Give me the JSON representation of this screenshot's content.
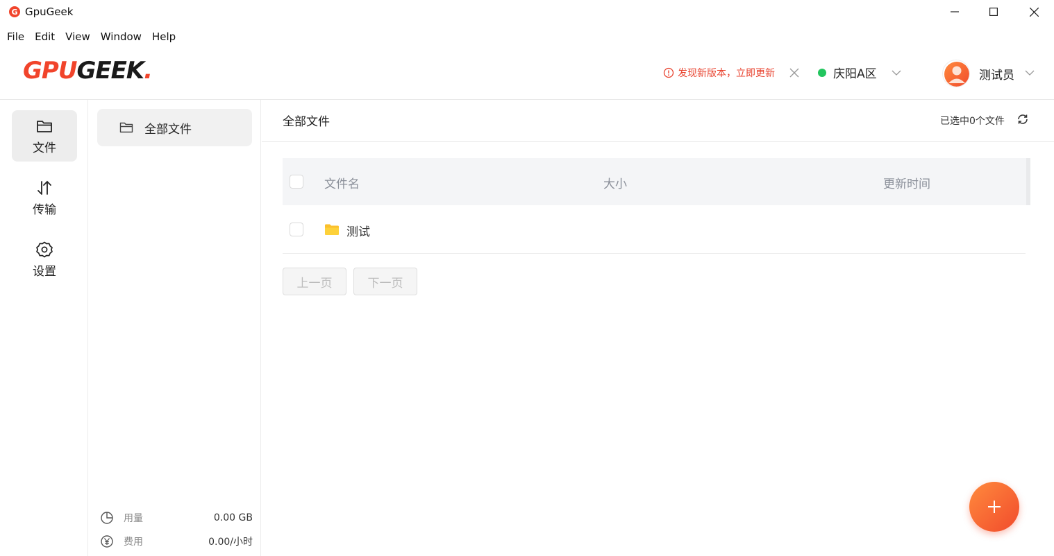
{
  "window": {
    "title": "GpuGeek",
    "icon": "gpugeek-app-icon"
  },
  "menu": [
    "File",
    "Edit",
    "View",
    "Window",
    "Help"
  ],
  "header": {
    "logo_gpu": "GPU",
    "logo_geek": "GEEK",
    "logo_dot": ".",
    "update_notice": "发现新版本，立即更新",
    "region": "庆阳A区",
    "user_name": "测试员"
  },
  "nav": [
    {
      "label": "文件",
      "icon": "folder-icon",
      "active": true
    },
    {
      "label": "传输",
      "icon": "transfer-arrows-icon",
      "active": false
    },
    {
      "label": "设置",
      "icon": "gear-icon",
      "active": false
    }
  ],
  "folders": {
    "all_files": "全部文件"
  },
  "stats": {
    "usage_label": "用量",
    "usage_value": "0.00 GB",
    "cost_label": "费用",
    "cost_value": "0.00/小时"
  },
  "main": {
    "title": "全部文件",
    "selected_count": "已选中0个文件",
    "columns": [
      "文件名",
      "大小",
      "更新时间"
    ],
    "rows": [
      {
        "name": "测试",
        "type": "folder",
        "size": "",
        "updated": ""
      }
    ],
    "prev_page": "上一页",
    "next_page": "下一页"
  },
  "colors": {
    "brand": "#f1442b",
    "region_status": "#22c55e",
    "folder_yellow": "#fbc02d"
  }
}
